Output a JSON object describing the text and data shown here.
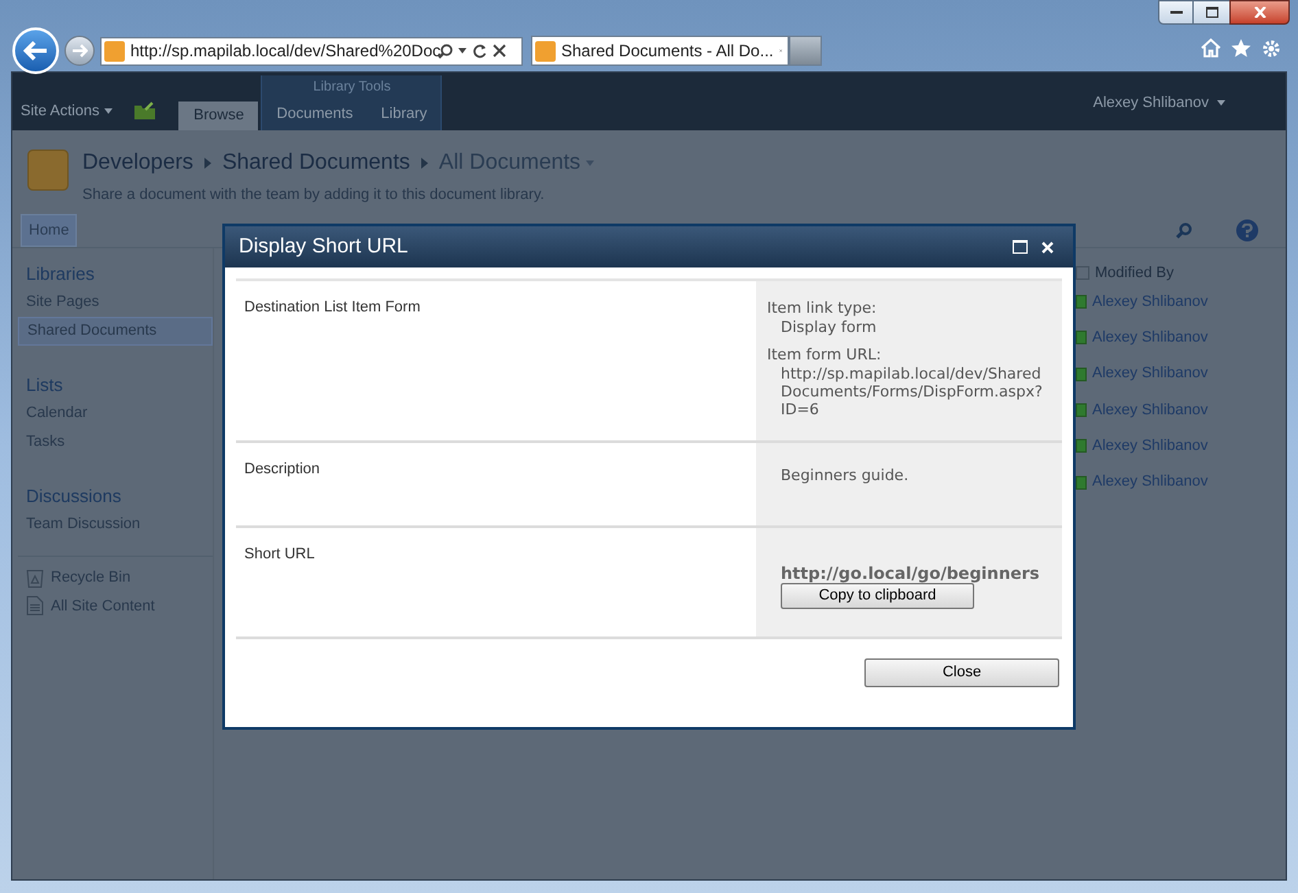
{
  "browser": {
    "address": "http://sp.mapilab.local/dev/Shared%20Doc",
    "tabs": [
      {
        "title": "Shared Documents - All Do...",
        "selected": true
      }
    ]
  },
  "ribbon": {
    "site_actions": "Site Actions",
    "tool_group": "Library Tools",
    "tabs": [
      {
        "label": "Browse",
        "selected": true
      },
      {
        "label": "Documents",
        "selected": false
      },
      {
        "label": "Library",
        "selected": false
      }
    ],
    "user": "Alexey Shlibanov"
  },
  "header": {
    "breadcrumb": [
      "Developers",
      "Shared Documents",
      "All Documents"
    ],
    "description": "Share a document with the team by adding it to this document library."
  },
  "top_nav": [
    {
      "label": "Home",
      "selected": true
    }
  ],
  "quick_launch": [
    {
      "heading": "Libraries",
      "items": [
        {
          "label": "Site Pages",
          "selected": false
        },
        {
          "label": "Shared Documents",
          "selected": true
        }
      ]
    },
    {
      "heading": "Lists",
      "items": [
        {
          "label": "Calendar",
          "selected": false
        },
        {
          "label": "Tasks",
          "selected": false
        }
      ]
    },
    {
      "heading": "Discussions",
      "items": [
        {
          "label": "Team Discussion",
          "selected": false
        }
      ]
    }
  ],
  "bottom_links": [
    {
      "kind": "recycle",
      "label": "Recycle Bin"
    },
    {
      "kind": "content",
      "label": "All Site Content"
    }
  ],
  "list": {
    "column": "Modified By",
    "select_all_checked": false,
    "rows": [
      "Alexey Shlibanov",
      "Alexey Shlibanov",
      "Alexey Shlibanov",
      "Alexey Shlibanov",
      "Alexey Shlibanov",
      "Alexey Shlibanov"
    ]
  },
  "dialog": {
    "title": "Display Short URL",
    "rows": [
      {
        "label": "Destination List Item Form",
        "kind": "fields",
        "fields": [
          {
            "name": "Item link type:",
            "value": "Display form"
          },
          {
            "name": "Item form URL:",
            "value": "http://sp.mapilab.local/dev/Shared Documents/Forms/DispForm.aspx?ID=6"
          }
        ]
      },
      {
        "label": "Description",
        "kind": "text",
        "text": "Beginners guide."
      },
      {
        "label": "Short URL",
        "kind": "short_url",
        "url": "http://go.local/go/beginners",
        "button": "Copy to clipboard"
      }
    ],
    "close": "Close"
  }
}
